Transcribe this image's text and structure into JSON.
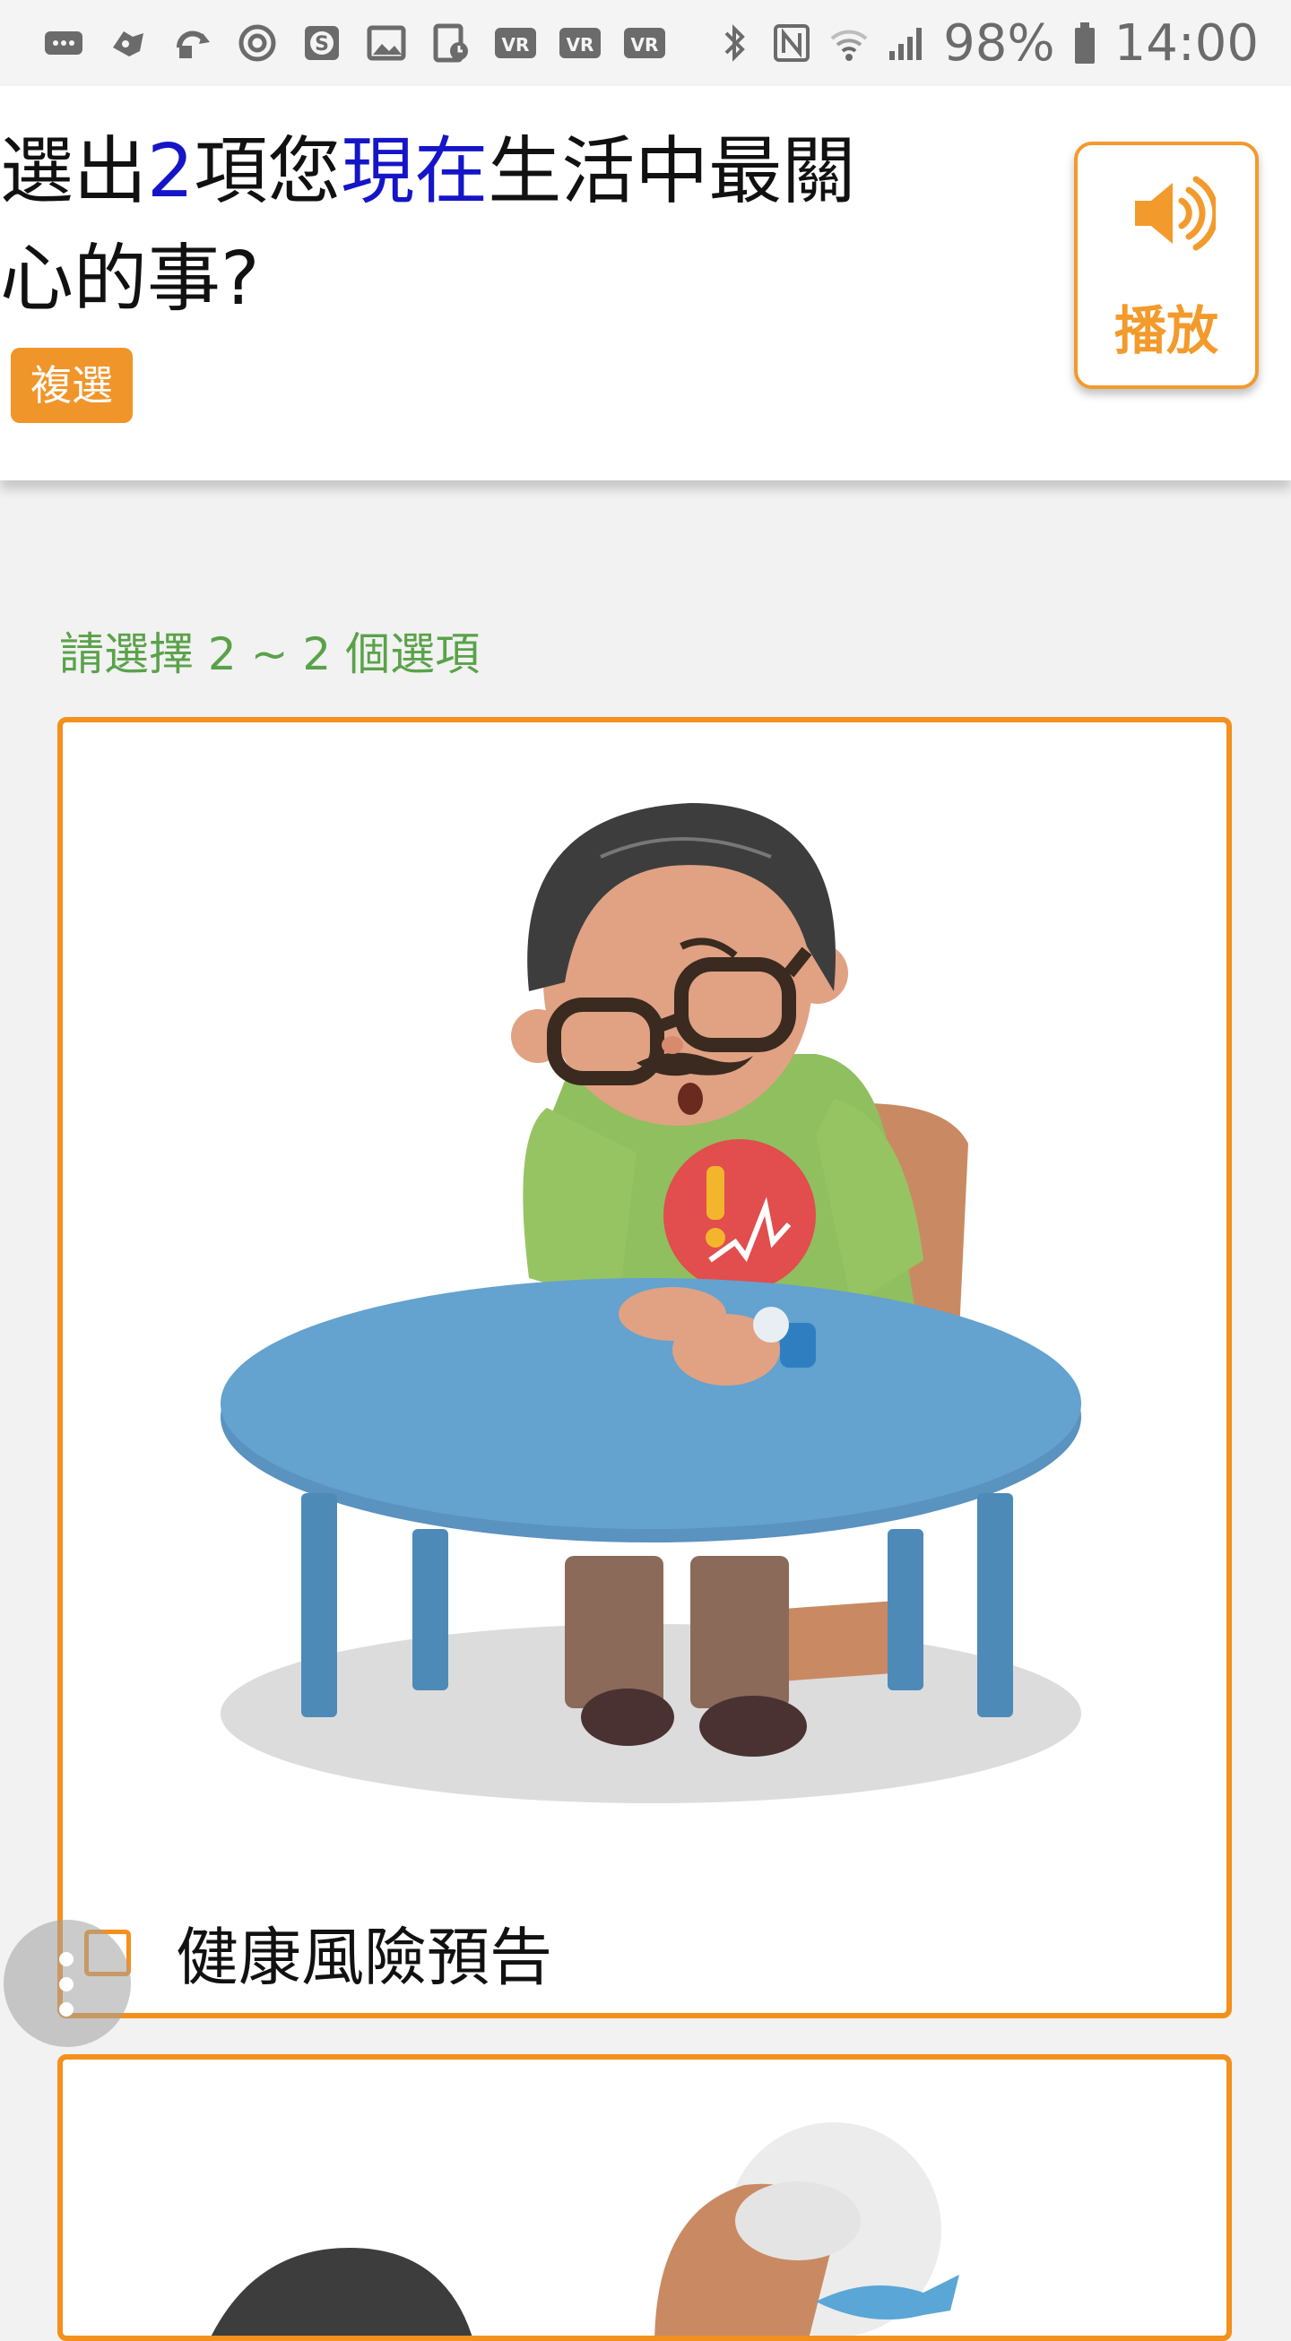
{
  "status_bar": {
    "battery": "98%",
    "time": "14:00",
    "left_icons": [
      "chat-icon",
      "game-icon",
      "sync-icon",
      "target-icon",
      "s-app-icon",
      "image-icon",
      "schedule-icon",
      "vr-icon",
      "vr-icon",
      "vr-icon"
    ],
    "vr_label": "VR",
    "right_icons": [
      "bluetooth-icon",
      "nfc-icon",
      "wifi-icon",
      "signal-icon",
      "battery-icon"
    ]
  },
  "question": {
    "title_part1": "選出",
    "title_num": "2",
    "title_part2": "項您",
    "title_highlight": "現在",
    "title_part3": "生活中最關",
    "title_line2": "心的事?",
    "badge": "複選",
    "play_label": "播放"
  },
  "hint": "請選擇 2 ~ 2 個選項",
  "options": [
    {
      "label": "健康風險預告",
      "checked": false
    },
    {
      "label": "",
      "checked": false
    }
  ],
  "colors": {
    "accent": "#f4901d",
    "highlight": "#1515c8",
    "hint": "#5aa24a"
  }
}
